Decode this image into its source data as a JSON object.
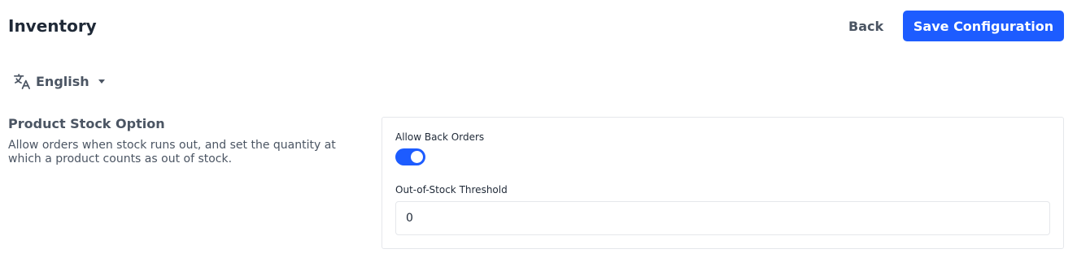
{
  "header": {
    "title": "Inventory",
    "back_label": "Back",
    "save_label": "Save Configuration"
  },
  "language": {
    "selected": "English",
    "icon": "translate-icon"
  },
  "section": {
    "title": "Product Stock Option",
    "description": "Allow orders when stock runs out, and set the quantity at which a product counts as out of stock."
  },
  "fields": {
    "allow_back_orders": {
      "label": "Allow Back Orders",
      "enabled": true
    },
    "out_of_stock_threshold": {
      "label": "Out-of-Stock Threshold",
      "value": "0"
    }
  },
  "colors": {
    "accent": "#1d5cff",
    "text_primary": "#1f2937",
    "text_secondary": "#4b5563",
    "border": "#e5e7eb"
  }
}
